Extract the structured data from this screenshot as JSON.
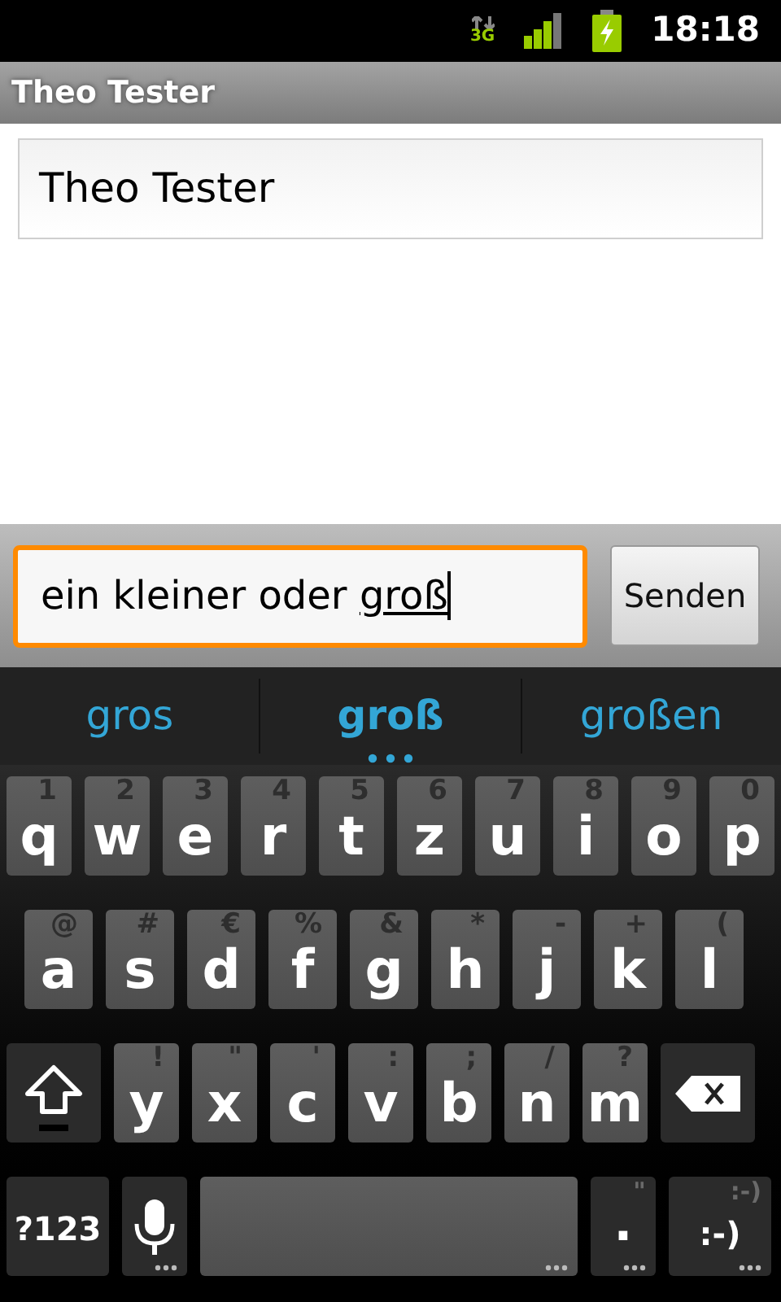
{
  "status_bar": {
    "network": "3G",
    "time": "18:18"
  },
  "title": "Theo Tester",
  "recipient_field": {
    "value": "Theo Tester"
  },
  "compose": {
    "text": "ein kleiner oder ",
    "composing": "groß",
    "button": "Senden"
  },
  "suggestions": [
    {
      "label": "gros",
      "selected": false
    },
    {
      "label": "groß",
      "selected": true
    },
    {
      "label": "großen",
      "selected": false
    }
  ],
  "keyboard": [
    [
      {
        "kind": "letter",
        "label": "q",
        "hint": "1"
      },
      {
        "kind": "letter",
        "label": "w",
        "hint": "2"
      },
      {
        "kind": "letter",
        "label": "e",
        "hint": "3"
      },
      {
        "kind": "letter",
        "label": "r",
        "hint": "4"
      },
      {
        "kind": "letter",
        "label": "t",
        "hint": "5"
      },
      {
        "kind": "letter",
        "label": "z",
        "hint": "6"
      },
      {
        "kind": "letter",
        "label": "u",
        "hint": "7"
      },
      {
        "kind": "letter",
        "label": "i",
        "hint": "8"
      },
      {
        "kind": "letter",
        "label": "o",
        "hint": "9"
      },
      {
        "kind": "letter",
        "label": "p",
        "hint": "0"
      }
    ],
    [
      {
        "kind": "letter",
        "label": "a",
        "hint": "@"
      },
      {
        "kind": "letter",
        "label": "s",
        "hint": "#"
      },
      {
        "kind": "letter",
        "label": "d",
        "hint": "€"
      },
      {
        "kind": "letter",
        "label": "f",
        "hint": "%"
      },
      {
        "kind": "letter",
        "label": "g",
        "hint": "&"
      },
      {
        "kind": "letter",
        "label": "h",
        "hint": "*"
      },
      {
        "kind": "letter",
        "label": "j",
        "hint": "-"
      },
      {
        "kind": "letter",
        "label": "k",
        "hint": "+"
      },
      {
        "kind": "letter",
        "label": "l",
        "hint": "("
      }
    ],
    [
      {
        "kind": "shift"
      },
      {
        "kind": "letter",
        "label": "y",
        "hint": "!"
      },
      {
        "kind": "letter",
        "label": "x",
        "hint": "\""
      },
      {
        "kind": "letter",
        "label": "c",
        "hint": "'"
      },
      {
        "kind": "letter",
        "label": "v",
        "hint": ":"
      },
      {
        "kind": "letter",
        "label": "b",
        "hint": ";"
      },
      {
        "kind": "letter",
        "label": "n",
        "hint": "/"
      },
      {
        "kind": "letter",
        "label": "m",
        "hint": "?"
      },
      {
        "kind": "delete"
      }
    ],
    [
      {
        "kind": "symbols",
        "label": "?123",
        "more": false
      },
      {
        "kind": "mic",
        "more": true
      },
      {
        "kind": "space",
        "more": true
      },
      {
        "kind": "period",
        "label": ".",
        "hint": "\"",
        "more": true
      },
      {
        "kind": "smiley",
        "label": ":-)",
        "hint": ":-)",
        "more": true
      }
    ]
  ]
}
